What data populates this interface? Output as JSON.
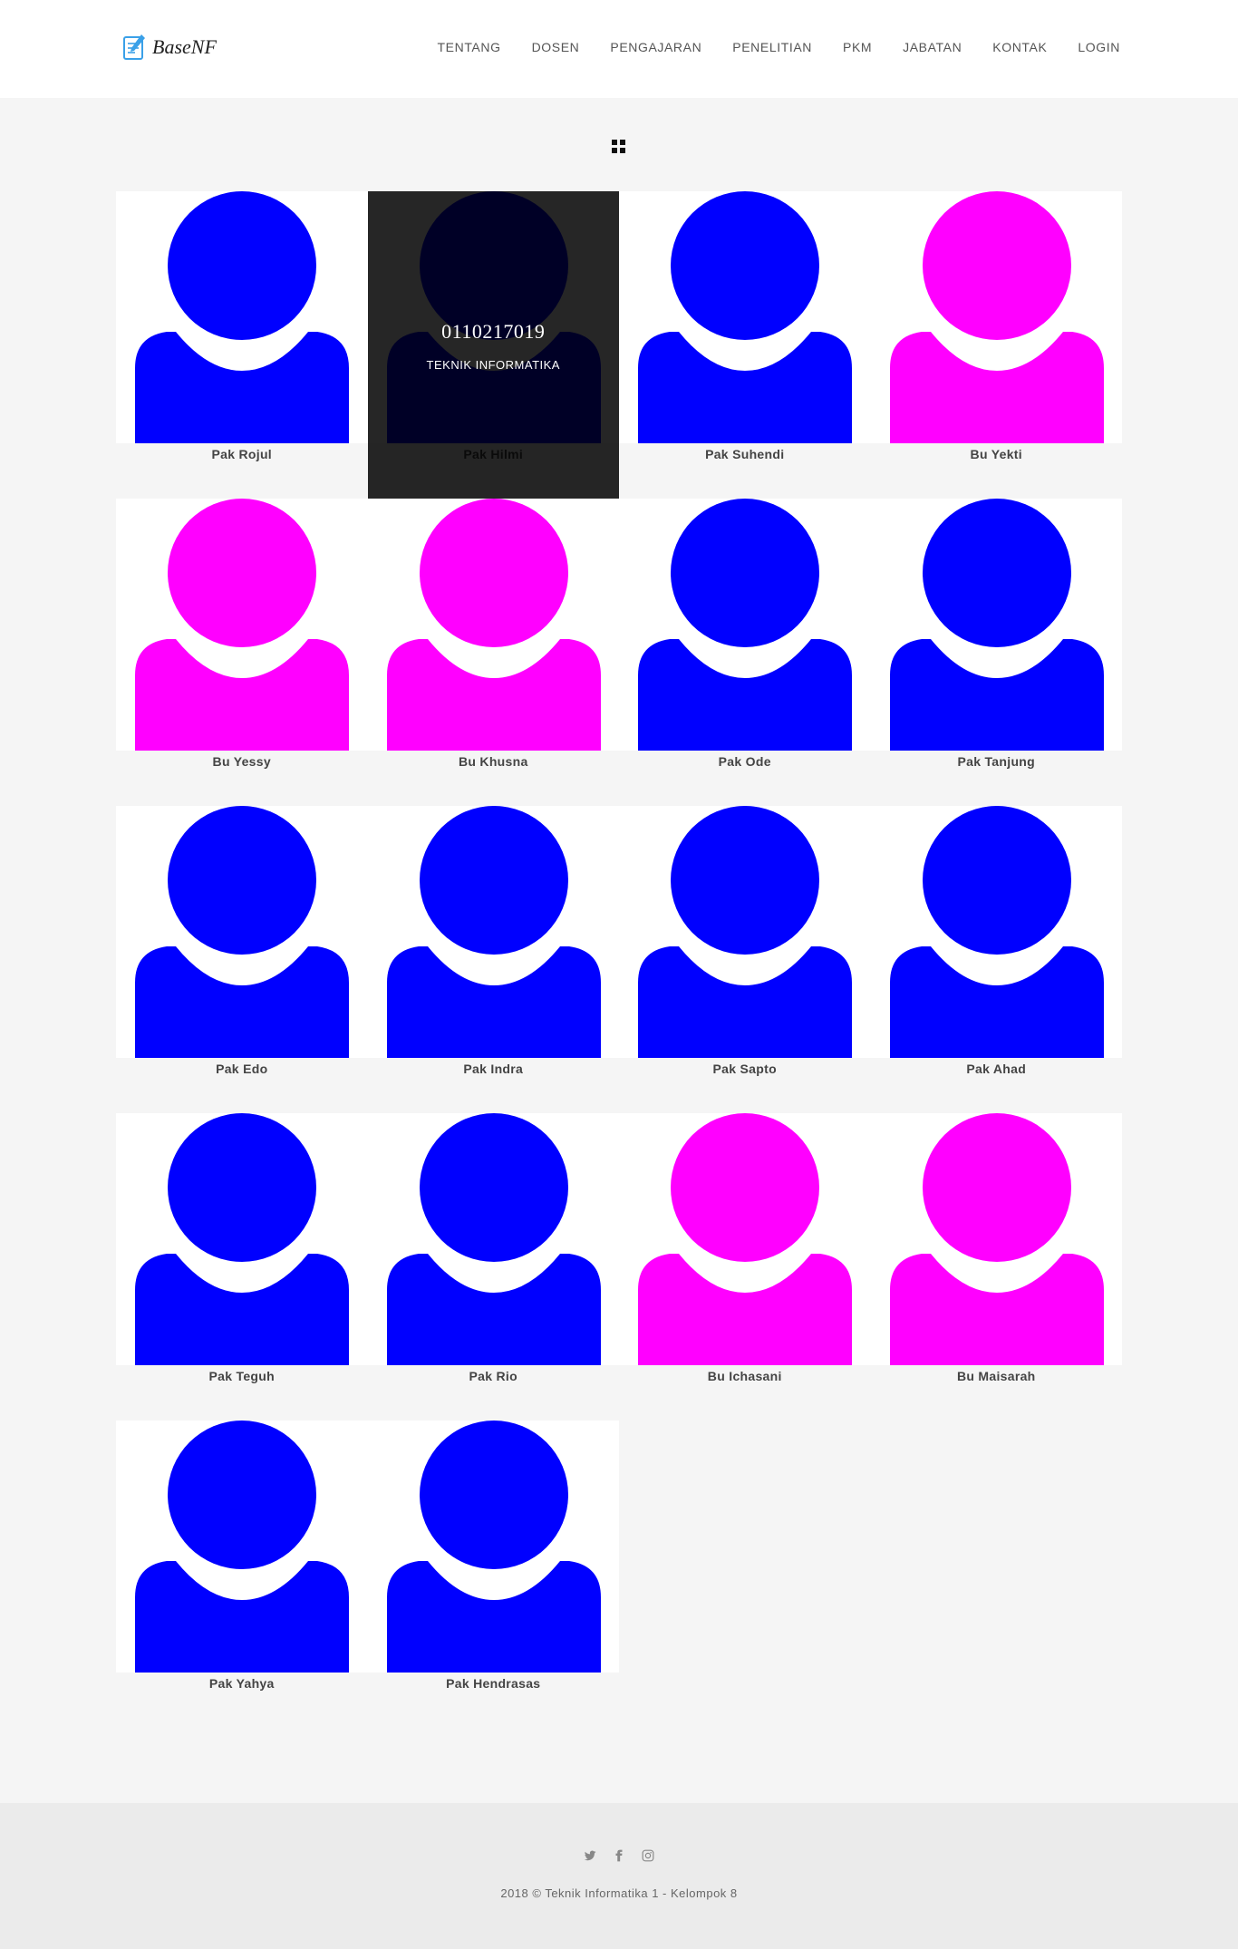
{
  "header": {
    "logo_text": "BaseNF",
    "nav": [
      "TENTANG",
      "DOSEN",
      "PENGAJARAN",
      "PENELITIAN",
      "PKM",
      "JABATAN",
      "KONTAK",
      "LOGIN"
    ]
  },
  "filter_icon": "grid-icon",
  "colors": {
    "male": "#0000ff",
    "female": "#ff00ff",
    "overlay": "#222222"
  },
  "lecturers": [
    {
      "name": "Pak Rojul",
      "gender": "male"
    },
    {
      "name": "Pak Hilmi",
      "gender": "male",
      "hover": true,
      "id": "0110217019",
      "dept": "TEKNIK INFORMATIKA"
    },
    {
      "name": "Pak Suhendi",
      "gender": "male"
    },
    {
      "name": "Bu Yekti",
      "gender": "female"
    },
    {
      "name": "Bu Yessy",
      "gender": "female"
    },
    {
      "name": "Bu Khusna",
      "gender": "female"
    },
    {
      "name": "Pak Ode",
      "gender": "male"
    },
    {
      "name": "Pak Tanjung",
      "gender": "male"
    },
    {
      "name": "Pak Edo",
      "gender": "male"
    },
    {
      "name": "Pak Indra",
      "gender": "male"
    },
    {
      "name": "Pak Sapto",
      "gender": "male"
    },
    {
      "name": "Pak Ahad",
      "gender": "male"
    },
    {
      "name": "Pak Teguh",
      "gender": "male"
    },
    {
      "name": "Pak Rio",
      "gender": "male"
    },
    {
      "name": "Bu Ichasani",
      "gender": "female"
    },
    {
      "name": "Bu Maisarah",
      "gender": "female"
    },
    {
      "name": "Pak Yahya",
      "gender": "male"
    },
    {
      "name": "Pak Hendrasas",
      "gender": "male"
    }
  ],
  "footer": {
    "social": [
      "twitter-icon",
      "facebook-icon",
      "instagram-icon"
    ],
    "copyright": "2018 © Teknik Informatika 1 - Kelompok 8"
  }
}
